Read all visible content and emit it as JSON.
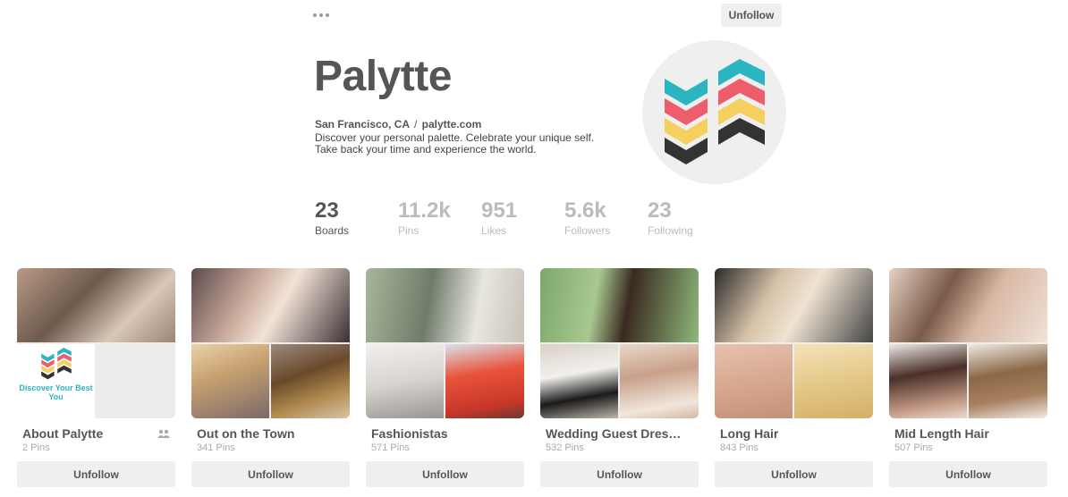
{
  "header": {
    "more_icon": "more-dots-icon",
    "unfollow_label": "Unfollow"
  },
  "profile": {
    "name": "Palytte",
    "location": "San Francisco, CA",
    "website": "palytte.com",
    "description_line1": "Discover your personal palette. Celebrate your unique self.",
    "description_line2": "Take back your time and experience the world.",
    "logo_colors": [
      "#2bb5c0",
      "#ee5d6c",
      "#f5d05f",
      "#333333"
    ]
  },
  "stats": [
    {
      "value": "23",
      "label": "Boards"
    },
    {
      "value": "11.2k",
      "label": "Pins"
    },
    {
      "value": "951",
      "label": "Likes"
    },
    {
      "value": "5.6k",
      "label": "Followers"
    },
    {
      "value": "23",
      "label": "Following"
    }
  ],
  "boards": [
    {
      "title": "About Palytte",
      "pins": "2 Pins",
      "unfollow": "Unfollow",
      "group_icon": "group-icon",
      "cover_text": "Discover Your Best You"
    },
    {
      "title": "Out on the Town",
      "pins": "341 Pins",
      "unfollow": "Unfollow"
    },
    {
      "title": "Fashionistas",
      "pins": "571 Pins",
      "unfollow": "Unfollow"
    },
    {
      "title": "Wedding Guest Dres…",
      "pins": "532 Pins",
      "unfollow": "Unfollow"
    },
    {
      "title": "Long Hair",
      "pins": "843 Pins",
      "unfollow": "Unfollow"
    },
    {
      "title": "Mid Length Hair",
      "pins": "507 Pins",
      "unfollow": "Unfollow"
    }
  ]
}
